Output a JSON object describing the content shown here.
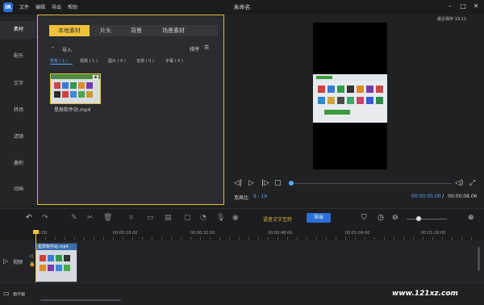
{
  "titlebar": {
    "logo": "iR",
    "menu": [
      "文件",
      "编辑",
      "导出",
      "帮助"
    ],
    "title": "未命名",
    "recent_save": "最近保存 19:11"
  },
  "nav": {
    "items": [
      "素材",
      "配乐",
      "文字",
      "转场",
      "滤镜",
      "叠附",
      "动画"
    ]
  },
  "library": {
    "tabs": [
      "本地素材",
      "片头",
      "背景",
      "场景素材"
    ],
    "import": "导入",
    "sort": "排序",
    "filters": [
      "所有 ( 1 )",
      "视频 ( 1 )",
      "图片 ( 0 )",
      "音频 ( 0 )",
      "字幕 ( 0 )"
    ],
    "file_name": "星辰软件站.mp4"
  },
  "preview": {
    "aspect_label": "宽高比",
    "aspect_value": "9 : 16",
    "current_time": "00:00:00.00",
    "separator": "/",
    "total_time": "00:00:08.06"
  },
  "toolbar": {
    "speech_to_text": "语音文字互转",
    "export": "导出"
  },
  "ruler": {
    "ticks": [
      "00:00",
      "00:00:16.00",
      "00:00:32.00",
      "00:00:48.00",
      "00:01:04.00",
      "00:01:20.00"
    ]
  },
  "tracks": {
    "video_label": "视频",
    "audio_label": "画中画",
    "clip_name": "星辰软件站.mp4"
  },
  "watermark": "www.121xz.com"
}
